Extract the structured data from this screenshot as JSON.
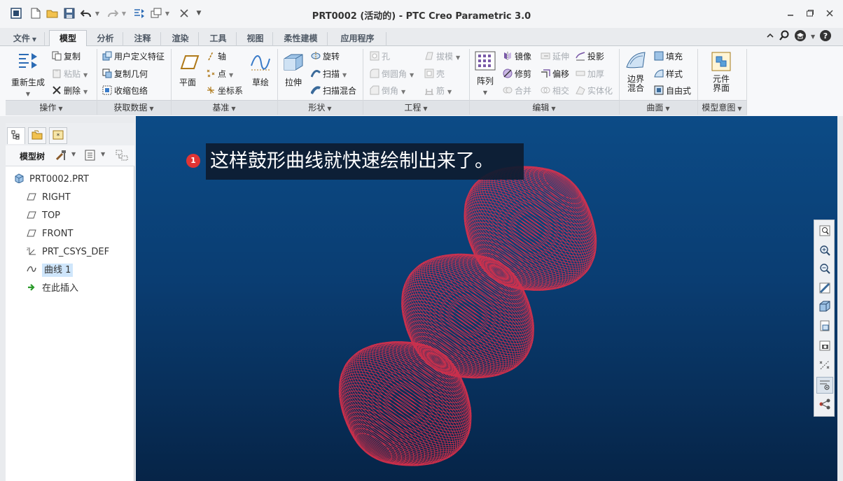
{
  "window": {
    "title": "PRT0002 (活动的) - PTC Creo Parametric 3.0"
  },
  "ribbon_tabs": [
    {
      "label": "文件",
      "has_dropdown": true
    },
    {
      "label": "模型",
      "active": true
    },
    {
      "label": "分析"
    },
    {
      "label": "注释"
    },
    {
      "label": "渲染"
    },
    {
      "label": "工具"
    },
    {
      "label": "视图"
    },
    {
      "label": "柔性建模"
    },
    {
      "label": "应用程序"
    }
  ],
  "groups": {
    "operations": {
      "label": "操作",
      "regenerate": "重新生成",
      "copy": "复制",
      "paste": "粘贴",
      "delete": "删除"
    },
    "get_data": {
      "label": "获取数据",
      "user_defined_feature": "用户定义特征",
      "copy_geometry": "复制几何",
      "shrinkwrap": "收缩包络"
    },
    "datum": {
      "label": "基准",
      "plane": "平面",
      "axis": "轴",
      "point": "点",
      "csys": "坐标系",
      "sketch": "草绘"
    },
    "shapes": {
      "label": "形状",
      "extrude": "拉伸",
      "revolve": "旋转",
      "sweep": "扫描",
      "swept_blend": "扫描混合"
    },
    "engineering": {
      "label": "工程",
      "hole": "孔",
      "draft": "拔模",
      "round": "倒圆角",
      "shell": "壳",
      "chamfer": "倒角",
      "rib": "筋"
    },
    "editing": {
      "label": "编辑",
      "pattern": "阵列",
      "mirror": "镜像",
      "extend": "延伸",
      "project": "投影",
      "trim": "修剪",
      "offset": "偏移",
      "thicken": "加厚",
      "merge": "合并",
      "intersect": "相交",
      "solidify": "实体化"
    },
    "surfaces": {
      "label": "曲面",
      "boundary_blend": "边界混合",
      "fill": "填充",
      "style": "样式",
      "freestyle": "自由式"
    },
    "model_intent": {
      "label": "模型意图",
      "component_interface": "元件界面"
    }
  },
  "model_tree": {
    "header": "模型树",
    "items": [
      {
        "label": "PRT0002.PRT",
        "icon": "part-icon"
      },
      {
        "label": "RIGHT",
        "icon": "datum-plane-icon"
      },
      {
        "label": "TOP",
        "icon": "datum-plane-icon"
      },
      {
        "label": "FRONT",
        "icon": "datum-plane-icon"
      },
      {
        "label": "PRT_CSYS_DEF",
        "icon": "csys-icon"
      },
      {
        "label": "曲线 1",
        "icon": "curve-icon",
        "selected": true
      },
      {
        "label": "在此插入",
        "icon": "insert-arrow-icon"
      }
    ]
  },
  "annotation": {
    "step": "1",
    "text": "这样鼓形曲线就快速绘制出来了。"
  },
  "colors": {
    "viewport_top": "#0c4b86",
    "viewport_bottom": "#062447",
    "curve": "#e0304a",
    "selection": "#cfe6fb"
  }
}
